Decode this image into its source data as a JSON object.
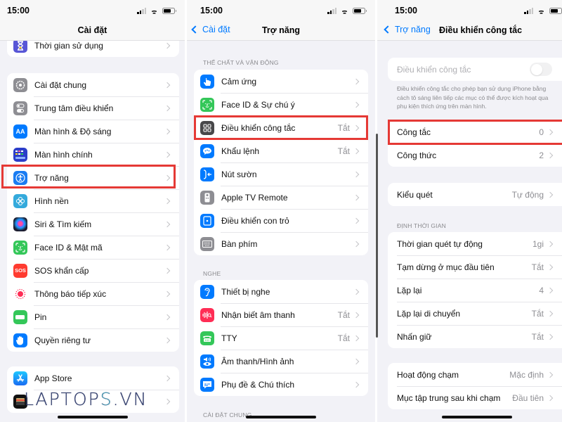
{
  "status_bar": {
    "time": "15:00"
  },
  "screens": [
    {
      "nav": {
        "title": "Cài đặt"
      },
      "groups": [
        {
          "rows": [
            {
              "label": "Thời gian sử dụng",
              "icon": "hourglass-icon",
              "color": "#5856d6"
            }
          ]
        },
        {
          "rows": [
            {
              "label": "Cài đặt chung",
              "icon": "gear-icon",
              "color": "#8e8e93"
            },
            {
              "label": "Trung tâm điều khiển",
              "icon": "toggles-icon",
              "color": "#8e8e93"
            },
            {
              "label": "Màn hình & Độ sáng",
              "icon": "text-size-icon",
              "color": "#007aff",
              "glyph": "AA"
            },
            {
              "label": "Màn hình chính",
              "icon": "home-grid-icon",
              "color": "#2c3ec9"
            },
            {
              "label": "Trợ năng",
              "icon": "accessibility-icon",
              "color": "#1a7cf2",
              "highlighted": true
            },
            {
              "label": "Hình nền",
              "icon": "wallpaper-icon",
              "color": "#34aadc"
            },
            {
              "label": "Siri & Tìm kiếm",
              "icon": "siri-icon",
              "color": "#1c1c2e"
            },
            {
              "label": "Face ID & Mật mã",
              "icon": "face-id-icon",
              "color": "#34c759"
            },
            {
              "label": "SOS khẩn cấp",
              "icon": "sos-icon",
              "color": "#ff3b30",
              "glyph": "SOS"
            },
            {
              "label": "Thông báo tiếp xúc",
              "icon": "exposure-icon",
              "color": "#ffffff"
            },
            {
              "label": "Pin",
              "icon": "battery-icon",
              "color": "#34c759"
            },
            {
              "label": "Quyền riêng tư",
              "icon": "hand-icon",
              "color": "#007aff"
            }
          ]
        },
        {
          "rows": [
            {
              "label": "App Store",
              "icon": "app-store-icon",
              "color": "#1e90ff"
            },
            {
              "label": "Ví",
              "icon": "wallet-icon",
              "color": "#111111"
            }
          ]
        }
      ]
    },
    {
      "nav": {
        "back": "Cài đặt",
        "title": "Trợ năng"
      },
      "sections": [
        {
          "header": "THỂ CHẤT VÀ VẬN ĐỘNG",
          "rows": [
            {
              "label": "Cảm ứng",
              "icon": "touch-hand-icon",
              "color": "#007aff"
            },
            {
              "label": "Face ID & Sự chú ý",
              "icon": "face-id-icon",
              "color": "#34c759"
            },
            {
              "label": "Điều khiển công tắc",
              "value": "Tắt",
              "icon": "switch-control-icon",
              "color": "#48484a",
              "highlighted": true
            },
            {
              "label": "Khẩu lệnh",
              "value": "Tắt",
              "icon": "voice-control-icon",
              "color": "#007aff"
            },
            {
              "label": "Nút sườn",
              "icon": "side-button-icon",
              "color": "#007aff"
            },
            {
              "label": "Apple TV Remote",
              "icon": "tv-remote-icon",
              "color": "#8e8e93"
            },
            {
              "label": "Điều khiển con trỏ",
              "icon": "pointer-icon",
              "color": "#007aff"
            },
            {
              "label": "Bàn phím",
              "icon": "keyboard-icon",
              "color": "#8e8e93"
            }
          ]
        },
        {
          "header": "NGHE",
          "rows": [
            {
              "label": "Thiết bị nghe",
              "icon": "ear-icon",
              "color": "#007aff"
            },
            {
              "label": "Nhận biết âm thanh",
              "value": "Tắt",
              "icon": "sound-recognition-icon",
              "color": "#ff2d55"
            },
            {
              "label": "TTY",
              "value": "Tắt",
              "icon": "tty-icon",
              "color": "#34c759"
            },
            {
              "label": "Âm thanh/Hình ảnh",
              "icon": "audio-visual-icon",
              "color": "#007aff"
            },
            {
              "label": "Phụ đề & Chú thích",
              "icon": "subtitles-icon",
              "color": "#007aff"
            }
          ]
        },
        {
          "header": "CÀI ĐẶT CHUNG",
          "rows": []
        }
      ]
    },
    {
      "nav": {
        "back": "Trợ năng",
        "title": "Điều khiển công tắc"
      },
      "toggle": {
        "label": "Điều khiển công tắc",
        "on": false,
        "disabled": true
      },
      "footnote": "Điều khiển công tắc cho phép bạn sử dụng iPhone bằng cách tô sáng liên tiếp các mục có thể được kích hoạt qua phụ kiện thích ứng trên màn hình.",
      "groups": [
        {
          "rows": [
            {
              "label": "Công tắc",
              "value": "0",
              "highlighted": true
            },
            {
              "label": "Công thức",
              "value": "2"
            }
          ]
        },
        {
          "rows": [
            {
              "label": "Kiểu quét",
              "value": "Tự động"
            }
          ]
        },
        {
          "header": "ĐỊNH THỜI GIAN",
          "rows": [
            {
              "label": "Thời gian quét tự động",
              "value": "1gi"
            },
            {
              "label": "Tạm dừng ở mục đầu tiên",
              "value": "Tắt"
            },
            {
              "label": "Lặp lại",
              "value": "4"
            },
            {
              "label": "Lặp lại di chuyển",
              "value": "Tắt"
            },
            {
              "label": "Nhấn giữ",
              "value": "Tắt"
            }
          ]
        },
        {
          "rows": [
            {
              "label": "Hoạt động chạm",
              "value": "Mặc định"
            },
            {
              "label": "Mục tập trung sau khi chạm",
              "value": "Đầu tiên"
            }
          ]
        }
      ]
    }
  ],
  "watermark": {
    "main": "LAPTOP",
    "accent": "S",
    "suffix": ".VN"
  },
  "highlight_color": "#e53935"
}
